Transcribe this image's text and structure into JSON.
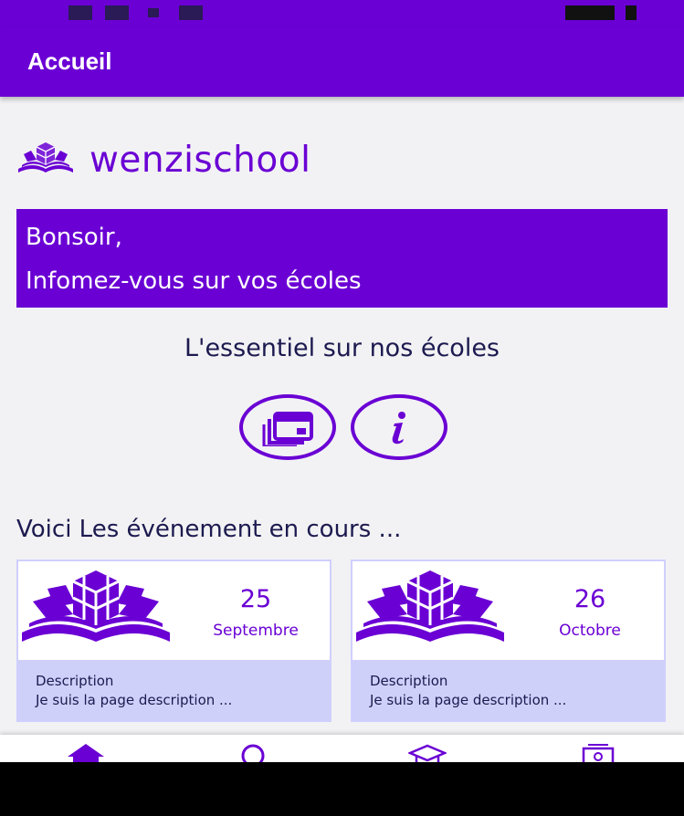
{
  "app_title": "Accueil",
  "brand": {
    "name": "wenzischool",
    "color": "#6a00d4"
  },
  "greeting": {
    "line1": "Bonsoir,",
    "line2": "Infomez-vous sur vos écoles"
  },
  "essentiel_title": "L'essentiel sur nos écoles",
  "quick_actions": [
    {
      "icon": "calendar-stack-icon"
    },
    {
      "icon": "info-icon"
    }
  ],
  "events_title": "Voici Les événement  en cours ...",
  "events": [
    {
      "day": "25",
      "month": "Septembre",
      "desc_label": "Description",
      "desc_text": "Je suis la page description ..."
    },
    {
      "day": "26",
      "month": "Octobre",
      "desc_label": "Description",
      "desc_text": "Je suis la page description ..."
    }
  ],
  "bottom_nav": [
    {
      "icon": "home-icon"
    },
    {
      "icon": "search-icon"
    },
    {
      "icon": "graduation-cap-icon"
    },
    {
      "icon": "contact-card-icon"
    }
  ]
}
